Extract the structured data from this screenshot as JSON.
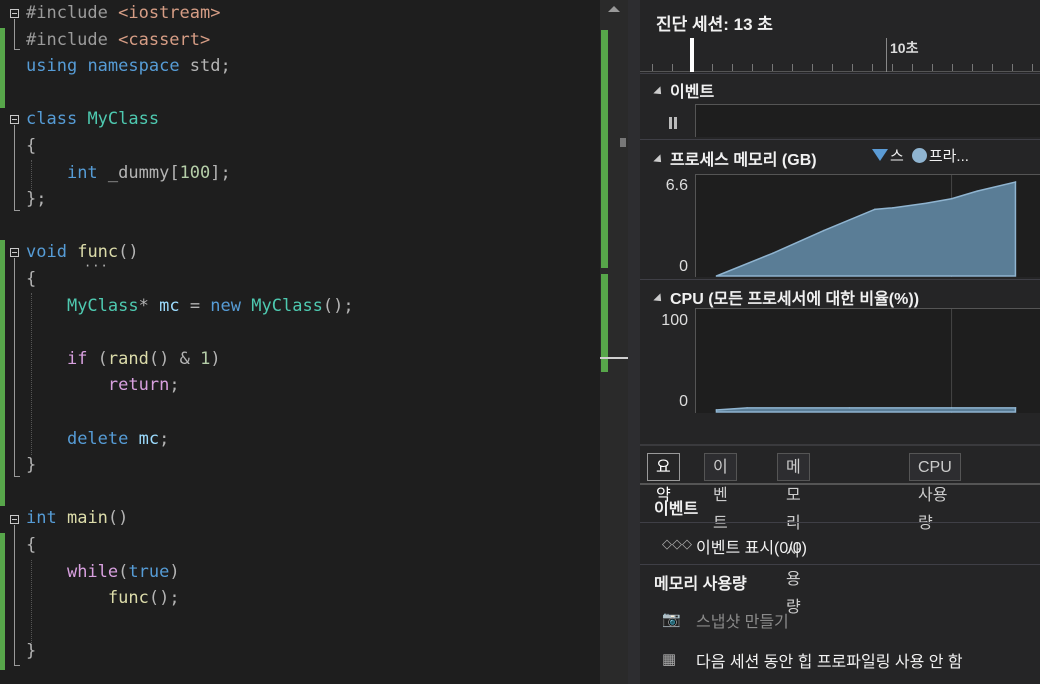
{
  "editor": {
    "lines": [
      {
        "segs": [
          [
            "pre",
            "#include "
          ],
          [
            "str",
            "<iostream>"
          ]
        ]
      },
      {
        "segs": [
          [
            "pre",
            "#include "
          ],
          [
            "str",
            "<cassert>"
          ]
        ]
      },
      {
        "segs": [
          [
            "kw",
            "using"
          ],
          [
            "op",
            " "
          ],
          [
            "kw",
            "namespace"
          ],
          [
            "op",
            " std;"
          ]
        ]
      },
      {
        "segs": []
      },
      {
        "segs": [
          [
            "kw",
            "class"
          ],
          [
            "op",
            " "
          ],
          [
            "ty",
            "MyClass"
          ]
        ]
      },
      {
        "segs": [
          [
            "op",
            "{"
          ]
        ]
      },
      {
        "segs": [
          [
            "op",
            "    "
          ],
          [
            "kw",
            "int"
          ],
          [
            "op",
            " _dummy["
          ],
          [
            "num",
            "100"
          ],
          [
            "op",
            "];"
          ]
        ]
      },
      {
        "segs": [
          [
            "op",
            "};"
          ]
        ]
      },
      {
        "segs": []
      },
      {
        "segs": [
          [
            "kw",
            "void"
          ],
          [
            "op",
            " "
          ],
          [
            "fn",
            "func"
          ],
          [
            "op",
            "()"
          ]
        ]
      },
      {
        "segs": [
          [
            "op",
            "{"
          ]
        ]
      },
      {
        "segs": [
          [
            "op",
            "    "
          ],
          [
            "ty",
            "MyClass"
          ],
          [
            "op",
            "* "
          ],
          [
            "id",
            "mc"
          ],
          [
            "op",
            " = "
          ],
          [
            "kw",
            "new"
          ],
          [
            "op",
            " "
          ],
          [
            "ty",
            "MyClass"
          ],
          [
            "op",
            "();"
          ]
        ]
      },
      {
        "segs": []
      },
      {
        "segs": [
          [
            "op",
            "    "
          ],
          [
            "kw2",
            "if"
          ],
          [
            "op",
            " ("
          ],
          [
            "fn",
            "rand"
          ],
          [
            "op",
            "() & "
          ],
          [
            "num",
            "1"
          ],
          [
            "op",
            ")"
          ]
        ]
      },
      {
        "segs": [
          [
            "op",
            "        "
          ],
          [
            "kw2",
            "return"
          ],
          [
            "op",
            ";"
          ]
        ]
      },
      {
        "segs": []
      },
      {
        "segs": [
          [
            "op",
            "    "
          ],
          [
            "kw",
            "delete"
          ],
          [
            "op",
            " "
          ],
          [
            "id",
            "mc"
          ],
          [
            "op",
            ";"
          ]
        ]
      },
      {
        "segs": [
          [
            "op",
            "}"
          ]
        ]
      },
      {
        "segs": []
      },
      {
        "segs": [
          [
            "kw",
            "int"
          ],
          [
            "op",
            " "
          ],
          [
            "fn",
            "main"
          ],
          [
            "op",
            "()"
          ]
        ]
      },
      {
        "segs": [
          [
            "op",
            "{"
          ]
        ]
      },
      {
        "segs": [
          [
            "op",
            "    "
          ],
          [
            "kw2",
            "while"
          ],
          [
            "op",
            "("
          ],
          [
            "kw",
            "true"
          ],
          [
            "op",
            ")"
          ]
        ]
      },
      {
        "segs": [
          [
            "op",
            "        "
          ],
          [
            "fn",
            "func"
          ],
          [
            "op",
            "();"
          ]
        ]
      },
      {
        "segs": []
      },
      {
        "segs": [
          [
            "op",
            "}"
          ]
        ]
      }
    ]
  },
  "diagnostics": {
    "session_title": "진단 세션: 13 초",
    "ruler_label": "10초",
    "events_section": "이벤트",
    "memory_section": "프로세스 메모리 (GB)",
    "legend_snapshot": "스",
    "legend_private": "프라...",
    "memory_ymax": "6.6",
    "memory_ymin": "0",
    "cpu_section": "CPU (모든 프로세서에 대한 비율(%))",
    "cpu_ymax": "100",
    "cpu_ymin": "0",
    "colors": {
      "series_fill": "#5a7d96",
      "series_stroke": "#8fb4d0",
      "snapshot": "#5b9bd5"
    }
  },
  "chart_data": [
    {
      "type": "area",
      "title": "프로세스 메모리 (GB)",
      "x_unit": "s",
      "x": [
        0.8,
        3,
        5,
        7,
        7.7,
        9,
        10,
        11,
        12.5
      ],
      "values": [
        0,
        1.5,
        3.0,
        4.4,
        4.5,
        4.8,
        5.1,
        5.6,
        6.2
      ],
      "ylim": [
        0,
        6.6
      ]
    },
    {
      "type": "area",
      "title": "CPU (모든 프로세서에 대한 비율(%))",
      "x_unit": "s",
      "x": [
        0.8,
        2,
        6,
        10,
        12.5
      ],
      "values": [
        2,
        4,
        4,
        4,
        4
      ],
      "ylim": [
        0,
        100
      ]
    }
  ],
  "tabs": [
    "요약",
    "이벤트",
    "메모리 사용량",
    "CPU 사용량"
  ],
  "summary": {
    "events_header": "이벤트",
    "show_events": "이벤트 표시(0/0)",
    "memory_header": "메모리 사용량",
    "take_snapshot": "스냅샷 만들기",
    "heap_profiling": "다음 세션 동안 힙 프로파일링 사용 안 함"
  }
}
